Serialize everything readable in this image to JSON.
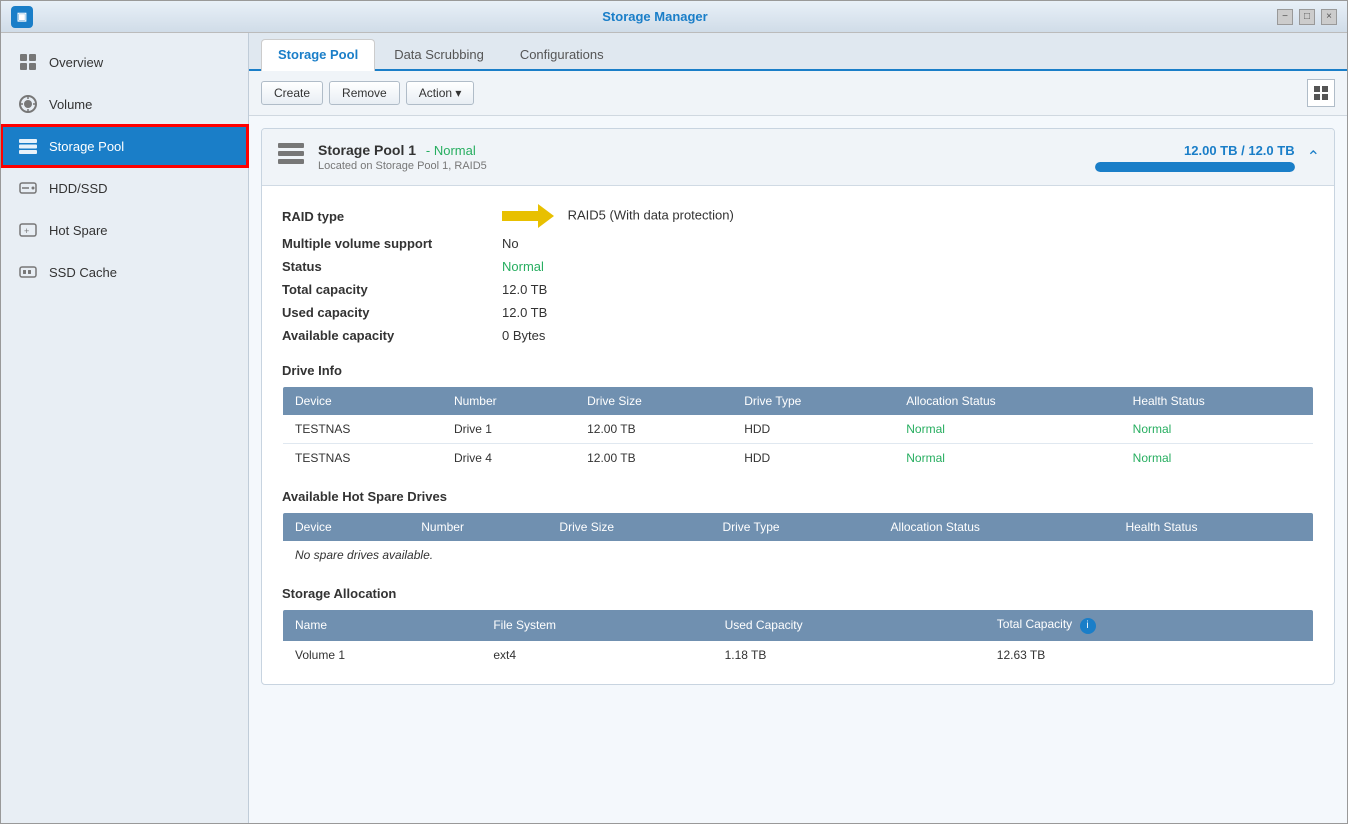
{
  "window": {
    "title": "Storage Manager"
  },
  "titlebar": {
    "minimize": "−",
    "maximize": "□",
    "close": "×"
  },
  "sidebar": {
    "items": [
      {
        "id": "overview",
        "label": "Overview",
        "icon": "overview"
      },
      {
        "id": "volume",
        "label": "Volume",
        "icon": "volume"
      },
      {
        "id": "storage-pool",
        "label": "Storage Pool",
        "icon": "storage-pool",
        "active": true
      },
      {
        "id": "hdd-ssd",
        "label": "HDD/SSD",
        "icon": "hdd"
      },
      {
        "id": "hot-spare",
        "label": "Hot Spare",
        "icon": "hot-spare"
      },
      {
        "id": "ssd-cache",
        "label": "SSD Cache",
        "icon": "ssd-cache"
      }
    ]
  },
  "tabs": [
    {
      "id": "storage-pool",
      "label": "Storage Pool",
      "active": true
    },
    {
      "id": "data-scrubbing",
      "label": "Data Scrubbing",
      "active": false
    },
    {
      "id": "configurations",
      "label": "Configurations",
      "active": false
    }
  ],
  "toolbar": {
    "create": "Create",
    "remove": "Remove",
    "action": "Action ▾"
  },
  "pool": {
    "title": "Storage Pool 1",
    "status_badge": "- Normal",
    "subtitle": "Located on Storage Pool 1, RAID5",
    "capacity_text": "12.00 TB / 12.0  TB",
    "capacity_percent": 100,
    "raid_type_label": "RAID type",
    "raid_type_value": "RAID5  (With data protection)",
    "multiple_volume_label": "Multiple volume support",
    "multiple_volume_value": "No",
    "status_label": "Status",
    "status_value": "Normal",
    "total_capacity_label": "Total capacity",
    "total_capacity_value": "12.0  TB",
    "used_capacity_label": "Used capacity",
    "used_capacity_value": "12.0  TB",
    "available_capacity_label": "Available capacity",
    "available_capacity_value": "0 Bytes",
    "drive_info": {
      "section_title": "Drive Info",
      "columns": [
        "Device",
        "Number",
        "Drive Size",
        "Drive Type",
        "Allocation Status",
        "Health Status"
      ],
      "rows": [
        {
          "device": "TESTNAS",
          "number": "Drive 1",
          "size": "12.00 TB",
          "type": "HDD",
          "allocation": "Normal",
          "health": "Normal"
        },
        {
          "device": "TESTNAS",
          "number": "Drive 4",
          "size": "12.00 TB",
          "type": "HDD",
          "allocation": "Normal",
          "health": "Normal"
        }
      ]
    },
    "hot_spare": {
      "section_title": "Available Hot Spare Drives",
      "columns": [
        "Device",
        "Number",
        "Drive Size",
        "Drive Type",
        "Allocation Status",
        "Health Status"
      ],
      "no_data": "No spare drives available."
    },
    "storage_allocation": {
      "section_title": "Storage Allocation",
      "columns": [
        "Name",
        "File System",
        "Used Capacity",
        "Total Capacity"
      ],
      "rows": [
        {
          "name": "Volume 1",
          "fs": "ext4",
          "used": "1.18 TB",
          "total": "12.63 TB"
        }
      ]
    }
  }
}
